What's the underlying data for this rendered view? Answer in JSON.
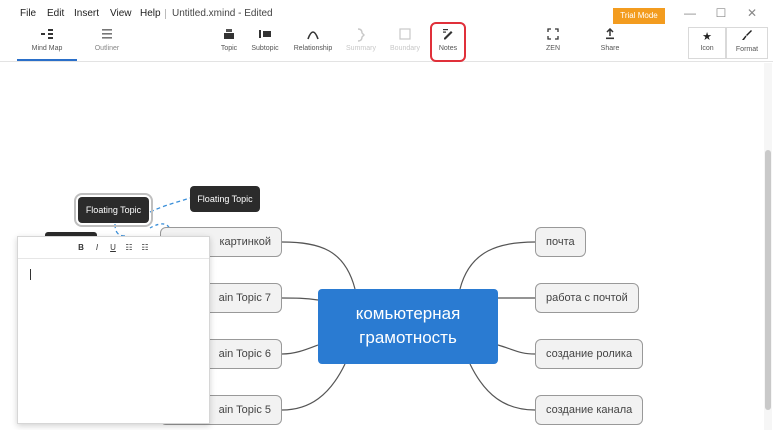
{
  "menu": {
    "file": "File",
    "edit": "Edit",
    "insert": "Insert",
    "view": "View",
    "help": "Help",
    "doc_title": "Untitled.xmind - Edited"
  },
  "trial_label": "Trial Mode",
  "window": {
    "minimize": "—",
    "maximize": "☐",
    "close": "✕"
  },
  "views": [
    {
      "label": "Mind Map",
      "icon": "mindmap-icon",
      "active": true
    },
    {
      "label": "Outliner",
      "icon": "outliner-icon",
      "active": false
    }
  ],
  "tools": {
    "topic": "Topic",
    "subtopic": "Subtopic",
    "relationship": "Relationship",
    "summary": "Summary",
    "boundary": "Boundary",
    "notes": "Notes",
    "zen": "ZEN",
    "share": "Share",
    "icon": "Icon",
    "format": "Format"
  },
  "mindmap": {
    "central": {
      "line1": "комьютерная",
      "line2": "грамотность"
    },
    "right_topics": [
      "почта",
      "работа с почтой",
      "создание ролика",
      "создание канала"
    ],
    "left_topics": [
      "картинкой",
      "ain Topic 7",
      "ain Topic 6",
      "ain Topic 5"
    ],
    "floating_topics": [
      "Floating Topic",
      "Floating Topic"
    ]
  },
  "notes_toolbar": {
    "bold": "B",
    "italic": "I",
    "underline": "U",
    "bullets": "☷",
    "numbers": "☷"
  },
  "colors": {
    "central": "#2a7bd2",
    "trial": "#f39c1f",
    "highlight": "#e0303a",
    "floating": "#2b2b2b"
  }
}
